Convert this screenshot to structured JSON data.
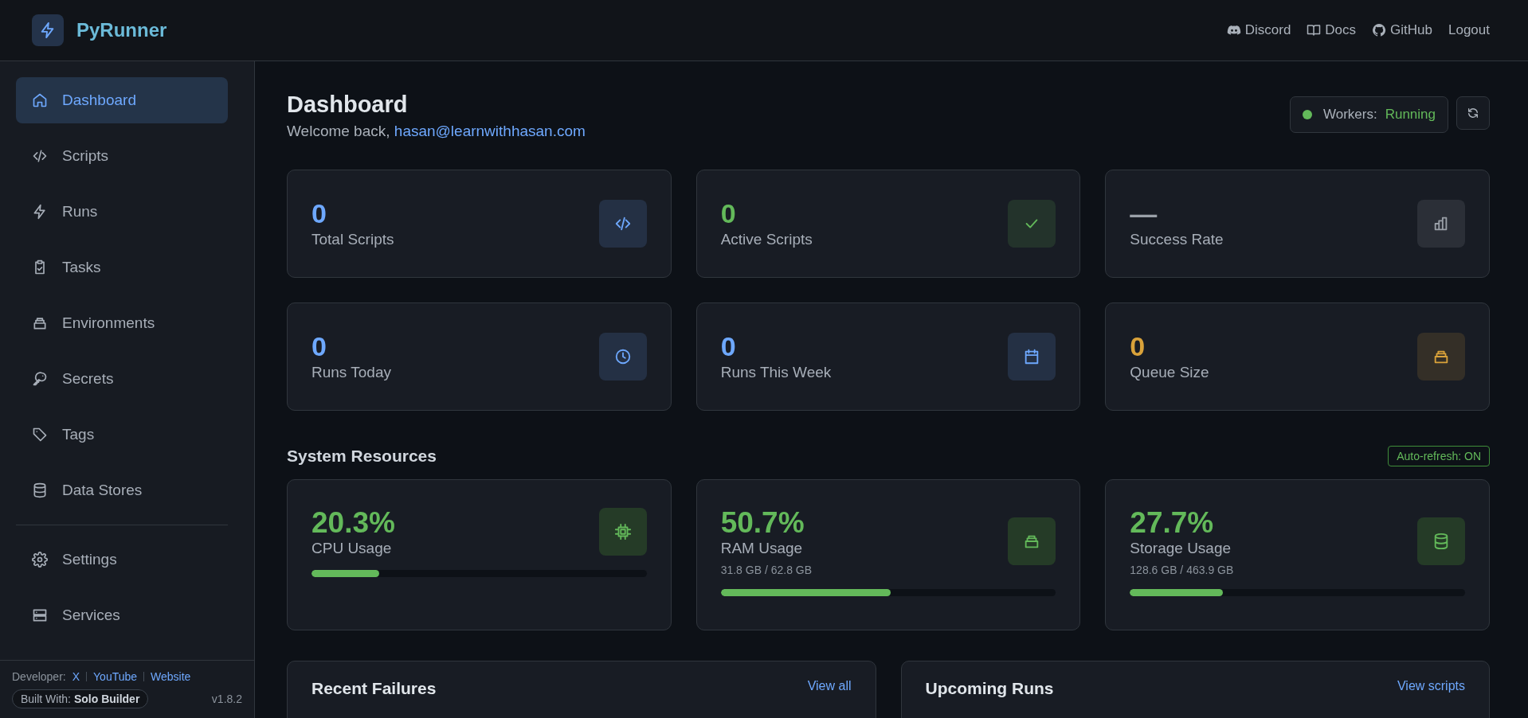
{
  "header": {
    "app_name": "PyRunner",
    "links": [
      {
        "label": "Discord"
      },
      {
        "label": "Docs"
      },
      {
        "label": "GitHub"
      },
      {
        "label": "Logout"
      }
    ]
  },
  "sidebar": {
    "items": [
      {
        "label": "Dashboard",
        "selected": true
      },
      {
        "label": "Scripts",
        "selected": false
      },
      {
        "label": "Runs",
        "selected": false
      },
      {
        "label": "Tasks",
        "selected": false
      },
      {
        "label": "Environments",
        "selected": false
      },
      {
        "label": "Secrets",
        "selected": false
      },
      {
        "label": "Tags",
        "selected": false
      },
      {
        "label": "Data Stores",
        "selected": false
      }
    ],
    "system_items": [
      {
        "label": "Settings",
        "selected": false
      },
      {
        "label": "Services",
        "selected": false
      }
    ],
    "footer": {
      "developer_label": "Developer:",
      "links": [
        "X",
        "YouTube",
        "Website"
      ],
      "built_with_label": "Built With:",
      "built_with": "Solo Builder",
      "version": "v1.8.2"
    }
  },
  "page": {
    "title": "Dashboard",
    "welcome": "Welcome back,",
    "email": "hasan@learnwithhasan.com",
    "workers": {
      "label": "Workers:",
      "status": "Running",
      "running": true
    }
  },
  "stats": [
    {
      "value": "0",
      "label": "Total Scripts",
      "color": "#6ea8fe"
    },
    {
      "value": "0",
      "label": "Active Scripts",
      "color": "#63b95a"
    },
    {
      "value": "—",
      "label": "Success Rate",
      "color": "#9aa0a8"
    },
    {
      "value": "0",
      "label": "Runs Today",
      "color": "#6ea8fe"
    },
    {
      "value": "0",
      "label": "Runs This Week",
      "color": "#6ea8fe"
    },
    {
      "value": "0",
      "label": "Queue Size",
      "color": "#d9a23a"
    }
  ],
  "system_resources": {
    "title": "System Resources",
    "auto_refresh": "Auto-refresh: ON",
    "items": [
      {
        "value": "20.3%",
        "label": "CPU Usage",
        "level": 0.203
      },
      {
        "value": "50.7%",
        "label": "RAM Usage",
        "detail": "31.8 GB / 62.8 GB",
        "level": 0.507
      },
      {
        "value": "27.7%",
        "label": "Storage Usage",
        "detail": "128.6 GB / 463.9 GB",
        "level": 0.277
      }
    ]
  },
  "panels": [
    {
      "title": "Recent Failures",
      "link": "View all"
    },
    {
      "title": "Upcoming Runs",
      "link": "View scripts"
    }
  ]
}
